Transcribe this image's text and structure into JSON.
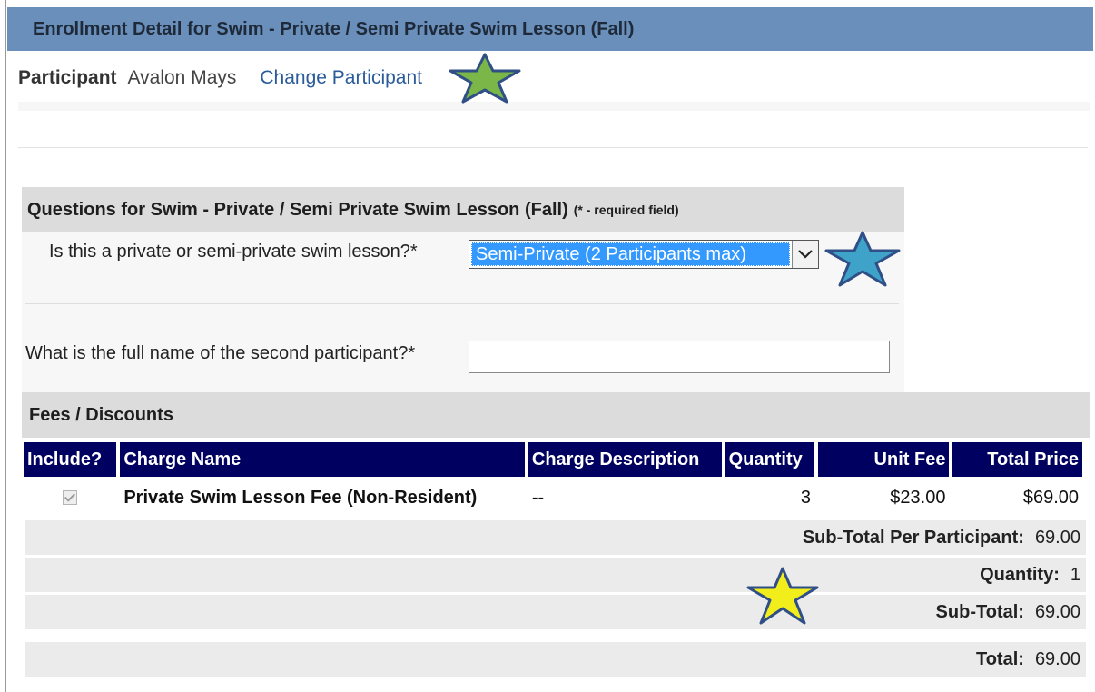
{
  "header": {
    "title": "Enrollment Detail for Swim - Private / Semi Private Swim Lesson (Fall)"
  },
  "participant": {
    "label": "Participant",
    "name": "Avalon Mays",
    "change_link": "Change Participant"
  },
  "questions": {
    "title": "Questions for Swim - Private / Semi Private Swim Lesson (Fall)",
    "required_note": "(* - required field)",
    "q1": {
      "label": "Is this a private or semi-private swim lesson?*",
      "selected": "Semi-Private (2 Participants max)"
    },
    "q2": {
      "label": "What is the full name of the second participant?*",
      "value": ""
    }
  },
  "fees": {
    "title": "Fees / Discounts",
    "columns": [
      "Include?",
      "Charge Name",
      "Charge Description",
      "Quantity",
      "Unit Fee",
      "Total Price"
    ],
    "rows": [
      {
        "include": true,
        "charge_name": "Private Swim Lesson Fee (Non-Resident)",
        "description": "--",
        "quantity": "3",
        "unit_fee": "$23.00",
        "total_price": "$69.00"
      }
    ],
    "subtotal_per_participant": {
      "label": "Sub-Total Per Participant:",
      "value": "69.00"
    },
    "quantity": {
      "label": "Quantity:",
      "value": "1"
    },
    "subtotal": {
      "label": "Sub-Total:",
      "value": "69.00"
    },
    "total": {
      "label": "Total:",
      "value": "69.00"
    }
  },
  "annotations": {
    "star_colors": [
      "#7ab648",
      "#3fa3c9",
      "#f2ee1c"
    ],
    "star_outline": "#2f4f86"
  }
}
